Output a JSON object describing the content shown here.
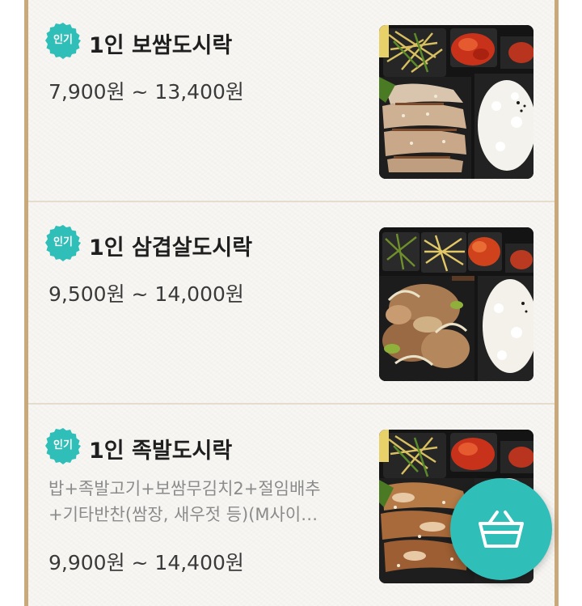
{
  "menu": {
    "items": [
      {
        "badge": "인기",
        "title": "1인 보쌈도시락",
        "price": "7,900원 ~ 13,400원",
        "image": "pork-bossam-lunchbox-photo"
      },
      {
        "badge": "인기",
        "title": "1인 삼겹살도시락",
        "price": "9,500원 ~ 14,000원",
        "image": "pork-belly-lunchbox-photo"
      },
      {
        "badge": "인기",
        "title": "1인 족발도시락",
        "description_line1": "밥+족발고기+보쌈무김치2+절임배추",
        "description_line2": "+기타반찬(쌈장, 새우젓 등)(M사이…",
        "price": "9,900원 ~ 14,400원",
        "image": "jokbal-lunchbox-photo"
      }
    ]
  },
  "cart": {
    "icon": "shopping-basket-icon"
  },
  "colors": {
    "badge": "#2fbfb8",
    "fab": "#2fbfb8",
    "frame_border": "#c9a87a",
    "divider": "#e6dccd"
  }
}
